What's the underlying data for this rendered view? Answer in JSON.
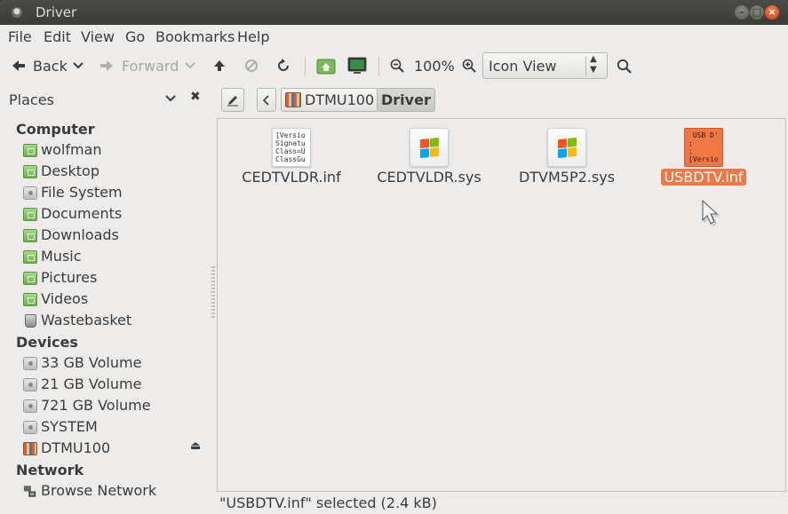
{
  "window": {
    "title": "Driver",
    "accent_color": "#f07746"
  },
  "menu": {
    "file": "File",
    "edit": "Edit",
    "view": "View",
    "go": "Go",
    "bookmarks": "Bookmarks",
    "help": "Help"
  },
  "toolbar": {
    "back": "Back",
    "forward": "Forward",
    "zoom": "100%",
    "view_mode": "Icon View"
  },
  "sidebar": {
    "header": "Places",
    "sections": {
      "computer": "Computer",
      "devices": "Devices",
      "network": "Network"
    },
    "computer_items": [
      "wolfman",
      "Desktop",
      "File System",
      "Documents",
      "Downloads",
      "Music",
      "Pictures",
      "Videos",
      "Wastebasket"
    ],
    "device_items": [
      "33 GB Volume",
      "21 GB Volume",
      "721 GB Volume",
      "SYSTEM",
      "DTMU100"
    ],
    "network_items": [
      "Browse Network"
    ]
  },
  "pathbar": {
    "crumbs": [
      "DTMU100",
      "Driver"
    ]
  },
  "files": [
    {
      "name": "CEDTVLDR.inf",
      "type": "inf",
      "preview": "[Versio\nSignatu\nClass=U\nClassGu",
      "selected": false
    },
    {
      "name": "CEDTVLDR.sys",
      "type": "sys",
      "selected": false
    },
    {
      "name": "DTVM5P2.sys",
      "type": "sys",
      "selected": false
    },
    {
      "name": "USBDTV.inf",
      "type": "inf",
      "preview": " USB D'\n;\n;\n[Versio",
      "selected": true
    }
  ],
  "status": {
    "text": "\"USBDTV.inf\" selected (2.4 kB)"
  }
}
